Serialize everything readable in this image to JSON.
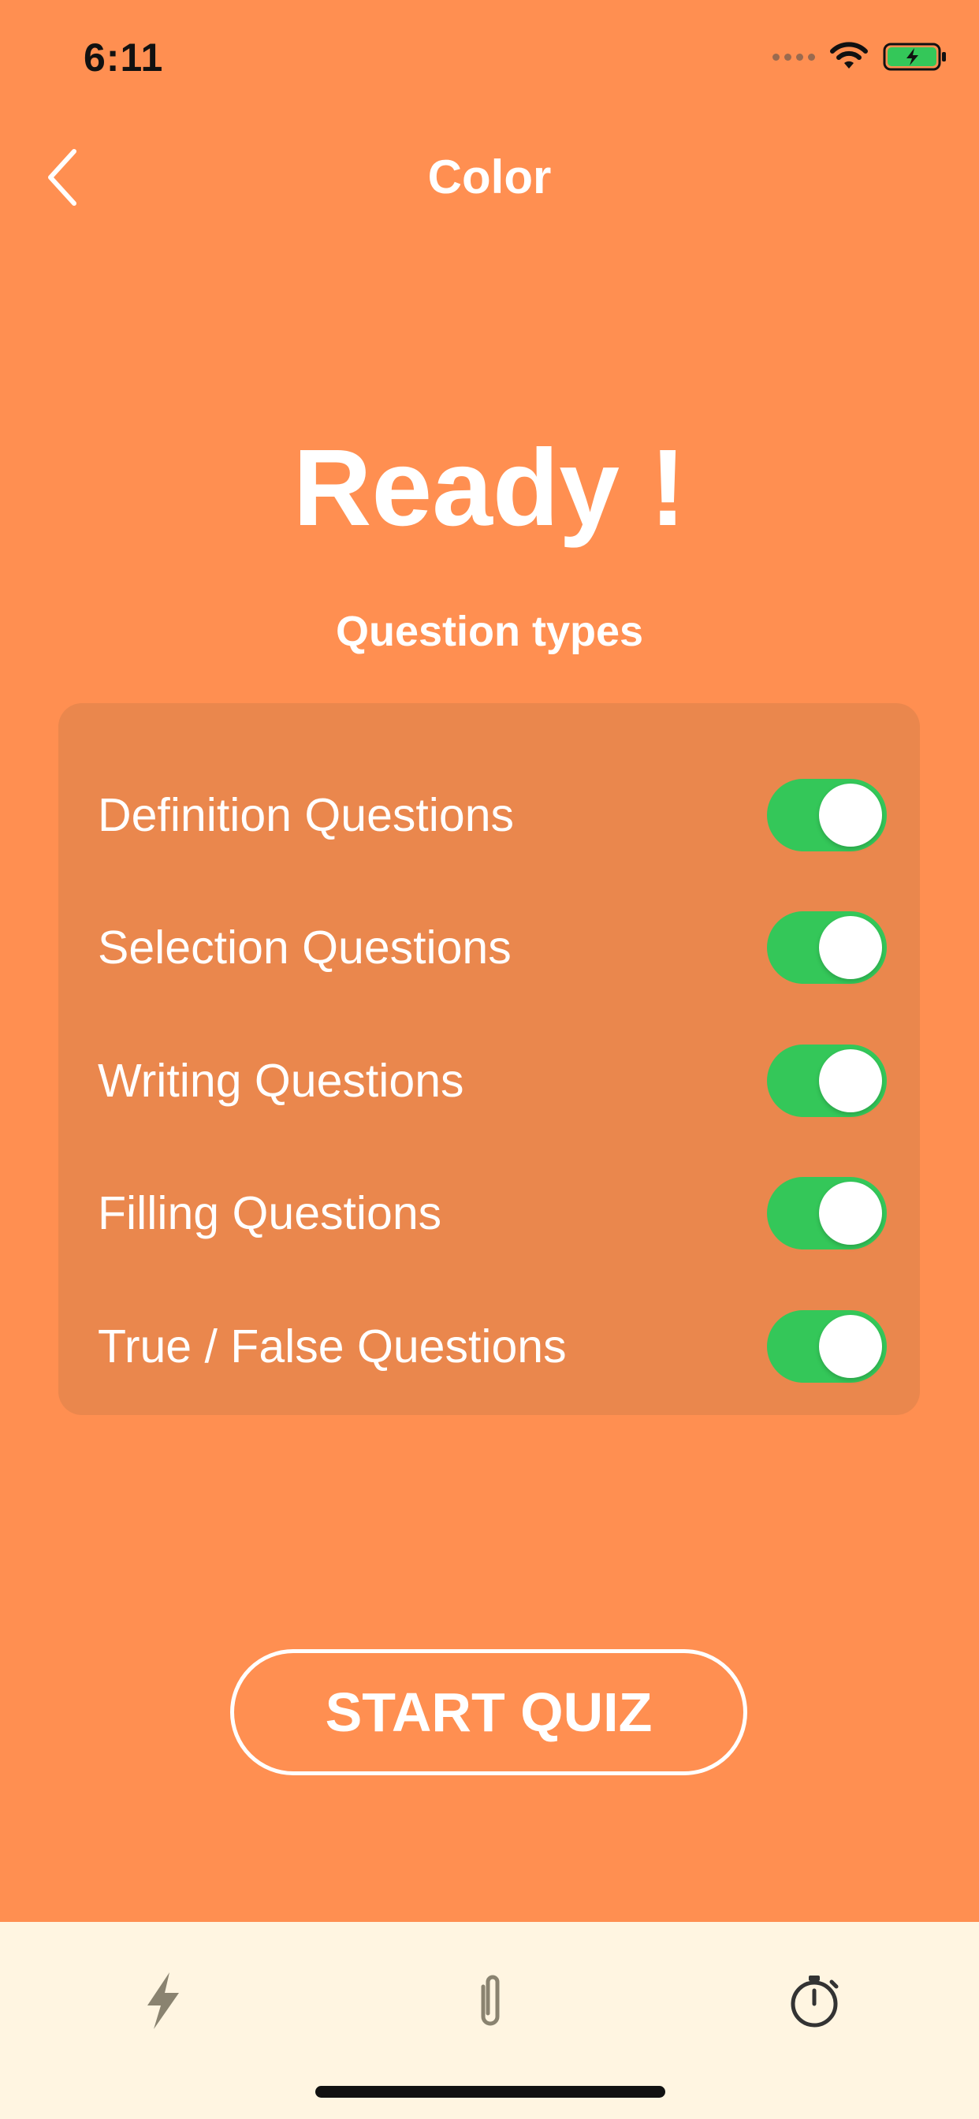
{
  "status_bar": {
    "time": "6:11"
  },
  "nav": {
    "title": "Color",
    "back_icon": "chevron-left-icon"
  },
  "main": {
    "heading": "Ready !",
    "section_label": "Question types",
    "options": [
      {
        "label": "Definition Questions",
        "enabled": true
      },
      {
        "label": "Selection Questions",
        "enabled": true
      },
      {
        "label": "Writing Questions",
        "enabled": true
      },
      {
        "label": "Filling Questions",
        "enabled": true
      },
      {
        "label": "True / False Questions",
        "enabled": true
      }
    ],
    "start_label": "START QUIZ"
  },
  "tab_bar": {
    "items": [
      {
        "icon": "lightning-icon"
      },
      {
        "icon": "paperclip-icon"
      },
      {
        "icon": "stopwatch-icon"
      }
    ]
  },
  "colors": {
    "background": "#FF8F51",
    "card": "#EA874D",
    "toggle_on": "#34C759",
    "tab_bar": "#FFF5E1",
    "tab_icon": "#8A8370"
  }
}
